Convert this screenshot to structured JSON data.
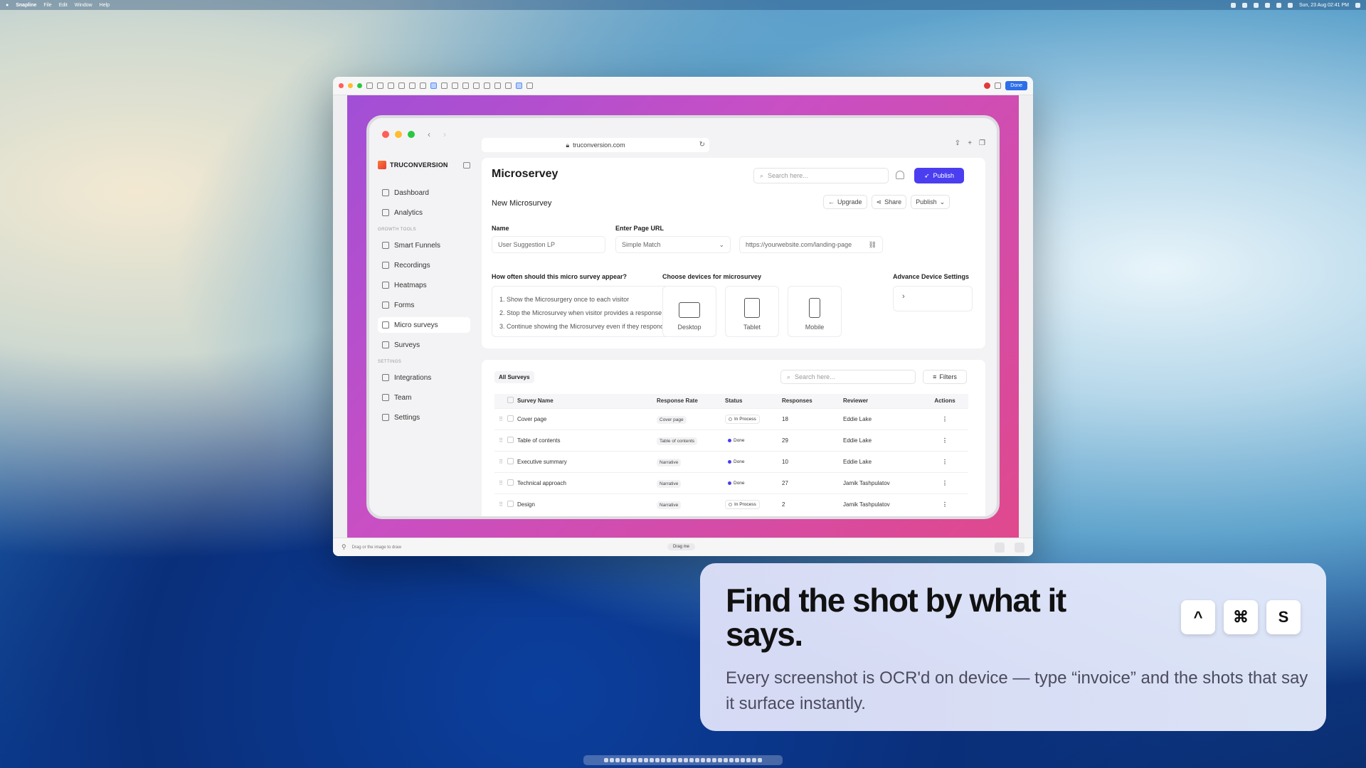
{
  "menubar": {
    "app": "Snapline",
    "items": [
      "File",
      "Edit",
      "Window",
      "Help"
    ],
    "clock": "Sun, 23 Aug 02:41 PM"
  },
  "snapline": {
    "done_label": "Done",
    "bottom_hint": "Drag or the image to draw",
    "drag_label": "Drag me"
  },
  "browser": {
    "url": "truconversion.com"
  },
  "sidebar": {
    "brand": "TRUCONVERSION",
    "items_top": [
      {
        "label": "Dashboard",
        "icon": "home-icon"
      },
      {
        "label": "Analytics",
        "icon": "chart-icon"
      }
    ],
    "section_growth": "GROWTH TOOLS",
    "items_growth": [
      {
        "label": "Smart Funnels",
        "icon": "funnel-icon"
      },
      {
        "label": "Recordings",
        "icon": "video-icon"
      },
      {
        "label": "Heatmaps",
        "icon": "heatmap-icon"
      },
      {
        "label": "Forms",
        "icon": "form-icon"
      },
      {
        "label": "Micro surveys",
        "icon": "microsurvey-icon"
      },
      {
        "label": "Surveys",
        "icon": "survey-icon"
      }
    ],
    "section_settings": "SETTINGS",
    "items_settings": [
      {
        "label": "Integrations",
        "icon": "integrations-icon"
      },
      {
        "label": "Team",
        "icon": "team-icon"
      },
      {
        "label": "Settings",
        "icon": "gear-icon"
      }
    ]
  },
  "main": {
    "title": "Microservey",
    "search_placeholder": "Search here...",
    "publish_label": "Publish",
    "subtitle": "New Microsurvey",
    "upgrade_label": "Upgrade",
    "share_label": "Share",
    "publish_dropdown_label": "Publish",
    "name_label": "Name",
    "name_value": "User Suggestion LP",
    "url_label": "Enter Page URL",
    "match_value": "Simple Match",
    "url_value": "https://yourwebsite.com/landing-page",
    "frequency_label": "How often should this micro survey appear?",
    "frequency_options": [
      "1. Show the Microsurgery once to each visitor",
      "2. Stop the Microsurvey when visitor provides a response",
      "3. Continue showing the Microsurvey even if they respond"
    ],
    "devices_label": "Choose devices for microsurvey",
    "devices": [
      "Desktop",
      "Tablet",
      "Mobile"
    ],
    "advanced_label": "Advance Device Settings"
  },
  "table": {
    "tab": "All Surveys",
    "search_placeholder": "Search here...",
    "filters_label": "Filters",
    "headers": [
      "Survey Name",
      "Response Rate",
      "Status",
      "Responses",
      "Reviewer",
      "Actions"
    ],
    "rows": [
      {
        "name": "Cover page",
        "rate": "Cover page",
        "status": "In Process",
        "responses": "18",
        "reviewer": "Eddie Lake"
      },
      {
        "name": "Table of contents",
        "rate": "Table of contents",
        "status": "Done",
        "responses": "29",
        "reviewer": "Eddie Lake"
      },
      {
        "name": "Executive summary",
        "rate": "Narrative",
        "status": "Done",
        "responses": "10",
        "reviewer": "Eddie Lake"
      },
      {
        "name": "Technical approach",
        "rate": "Narrative",
        "status": "Done",
        "responses": "27",
        "reviewer": "Jamik Tashpulatov"
      },
      {
        "name": "Design",
        "rate": "Narrative",
        "status": "In Process",
        "responses": "2",
        "reviewer": "Jamik Tashpulatov"
      }
    ]
  },
  "promo": {
    "headline": "Find the shot by what it says.",
    "body": "Every screenshot is OCR'd on device — type “invoice” and the shots that say it surface instantly.",
    "keys": [
      "^",
      "⌘",
      "S"
    ]
  },
  "colors": {
    "accent": "#4a3ef0",
    "done_dot": "#4a3ef0",
    "canvas_start": "#a14fd6",
    "canvas_end": "#e0498d"
  }
}
